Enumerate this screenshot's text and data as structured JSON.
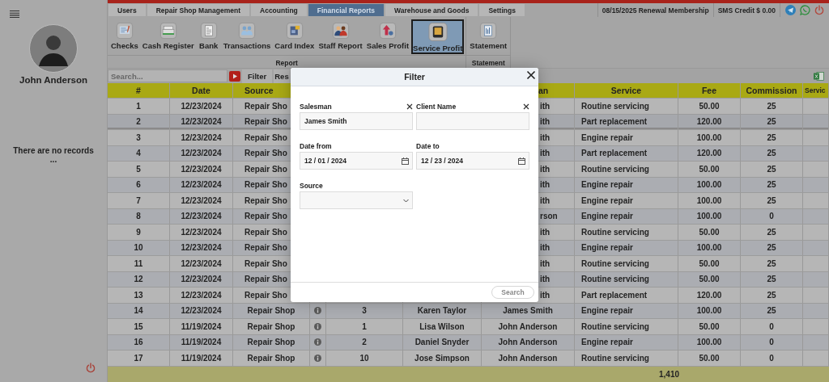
{
  "sidebar": {
    "user_name": "John Anderson",
    "empty_message": "There are no records",
    "empty_ellipsis": "..."
  },
  "tabs": [
    {
      "label": "Users",
      "selected": false
    },
    {
      "label": "Repair Shop Management",
      "selected": false
    },
    {
      "label": "Accounting",
      "selected": false
    },
    {
      "label": "Financial Reports",
      "selected": true
    },
    {
      "label": "Warehouse and Goods",
      "selected": false
    },
    {
      "label": "Settings",
      "selected": false
    }
  ],
  "status": {
    "renewal": "08/15/2025 Renewal Membership",
    "sms_credit": "SMS Credit $ 0.00"
  },
  "ribbon": {
    "groups": [
      {
        "label": "Report",
        "items": [
          {
            "label": "Checks",
            "kind": "checks",
            "selected": false
          },
          {
            "label": "Cash Register",
            "kind": "cash-register",
            "selected": false
          },
          {
            "label": "Bank",
            "kind": "bank",
            "selected": false
          },
          {
            "label": "Transactions",
            "kind": "transactions",
            "selected": false
          },
          {
            "label": "Card Index",
            "kind": "card-index",
            "selected": false
          },
          {
            "label": "Staff Report",
            "kind": "staff-report",
            "selected": false
          },
          {
            "label": "Sales Profit",
            "kind": "sales-profit",
            "selected": false
          },
          {
            "label": "Service Profit",
            "kind": "service-profit",
            "selected": true
          }
        ]
      },
      {
        "label": "Statement",
        "items": [
          {
            "label": "Statement",
            "kind": "statement",
            "selected": false
          }
        ]
      }
    ]
  },
  "toolbar": {
    "search_placeholder": "Search...",
    "buttons": [
      "Filter",
      "Res"
    ]
  },
  "table": {
    "header": {
      "covered": true,
      "cells": [
        "#",
        "Date",
        "Source",
        null,
        null,
        null,
        "an",
        "Service",
        "Fee",
        "Commission",
        "Servic"
      ]
    },
    "rows": [
      {
        "selected": false,
        "covered": true,
        "cells": [
          "1",
          "12/23/2024",
          "Repair Sho",
          null,
          null,
          null,
          "ith",
          "Routine servicing",
          "50.00",
          "25",
          null
        ]
      },
      {
        "selected": true,
        "covered": true,
        "cells": [
          "2",
          "12/23/2024",
          "Repair Sho",
          null,
          null,
          null,
          "ith",
          "Part replacement",
          "120.00",
          "25",
          null
        ]
      },
      {
        "selected": false,
        "covered": true,
        "cells": [
          "3",
          "12/23/2024",
          "Repair Sho",
          null,
          null,
          null,
          "ith",
          "Engine repair",
          "100.00",
          "25",
          null
        ]
      },
      {
        "selected": false,
        "covered": true,
        "cells": [
          "4",
          "12/23/2024",
          "Repair Sho",
          null,
          null,
          null,
          "ith",
          "Part replacement",
          "120.00",
          "25",
          null
        ]
      },
      {
        "selected": false,
        "covered": true,
        "cells": [
          "5",
          "12/23/2024",
          "Repair Sho",
          null,
          null,
          null,
          "ith",
          "Routine servicing",
          "50.00",
          "25",
          null
        ]
      },
      {
        "selected": false,
        "covered": true,
        "cells": [
          "6",
          "12/23/2024",
          "Repair Sho",
          null,
          null,
          null,
          "ith",
          "Engine repair",
          "100.00",
          "25",
          null
        ]
      },
      {
        "selected": false,
        "covered": true,
        "cells": [
          "7",
          "12/23/2024",
          "Repair Sho",
          null,
          null,
          null,
          "ith",
          "Engine repair",
          "100.00",
          "25",
          null
        ]
      },
      {
        "selected": false,
        "covered": true,
        "cells": [
          "8",
          "12/23/2024",
          "Repair Sho",
          null,
          null,
          null,
          "rson",
          "Engine repair",
          "100.00",
          "0",
          null
        ]
      },
      {
        "selected": false,
        "covered": true,
        "cells": [
          "9",
          "12/23/2024",
          "Repair Sho",
          null,
          null,
          null,
          "ith",
          "Routine servicing",
          "50.00",
          "25",
          null
        ]
      },
      {
        "selected": false,
        "covered": true,
        "cells": [
          "10",
          "12/23/2024",
          "Repair Sho",
          null,
          null,
          null,
          "ith",
          "Engine repair",
          "100.00",
          "25",
          null
        ]
      },
      {
        "selected": false,
        "covered": true,
        "cells": [
          "11",
          "12/23/2024",
          "Repair Sho",
          null,
          null,
          null,
          "ith",
          "Routine servicing",
          "50.00",
          "25",
          null
        ]
      },
      {
        "selected": false,
        "covered": true,
        "cells": [
          "12",
          "12/23/2024",
          "Repair Sho",
          null,
          null,
          null,
          "ith",
          "Routine servicing",
          "50.00",
          "25",
          null
        ]
      },
      {
        "selected": false,
        "covered": true,
        "cells": [
          "13",
          "12/23/2024",
          "Repair Sho",
          null,
          null,
          null,
          "ith",
          "Part replacement",
          "120.00",
          "25",
          null
        ]
      },
      {
        "selected": false,
        "covered": false,
        "cells": [
          "14",
          "12/23/2024",
          "Repair Shop",
          true,
          "3",
          "Karen Taylor",
          "James Smith",
          "Engine repair",
          "100.00",
          "25",
          null
        ]
      },
      {
        "selected": false,
        "covered": false,
        "cells": [
          "15",
          "11/19/2024",
          "Repair Shop",
          true,
          "1",
          "Lisa Wilson",
          "John Anderson",
          "Routine servicing",
          "50.00",
          "0",
          null
        ]
      },
      {
        "selected": false,
        "covered": false,
        "cells": [
          "16",
          "11/19/2024",
          "Repair Shop",
          true,
          "2",
          "Daniel Snyder",
          "John Anderson",
          "Engine repair",
          "100.00",
          "0",
          null
        ]
      },
      {
        "selected": false,
        "covered": false,
        "cells": [
          "17",
          "11/19/2024",
          "Repair Shop",
          true,
          "10",
          "Jose Simpson",
          "John Anderson",
          "Routine servicing",
          "50.00",
          "0",
          null
        ]
      }
    ],
    "total": {
      "fee": "1,410"
    }
  },
  "dialog": {
    "title": "Filter",
    "fields": [
      {
        "label": "Salesman",
        "kind": "text",
        "value": "James Smith",
        "clearable": true
      },
      {
        "label": "Client Name",
        "kind": "text",
        "clearable": true
      },
      {
        "label": "Date from",
        "kind": "date",
        "value": "12 / 01 / 2024",
        "clearable": false
      },
      {
        "label": "Date to",
        "kind": "date",
        "value": "12 / 23 / 2024",
        "clearable": false
      },
      {
        "label": "Source",
        "kind": "select",
        "clearable": false
      }
    ],
    "button": {
      "label": "Search",
      "disabled": true
    }
  }
}
